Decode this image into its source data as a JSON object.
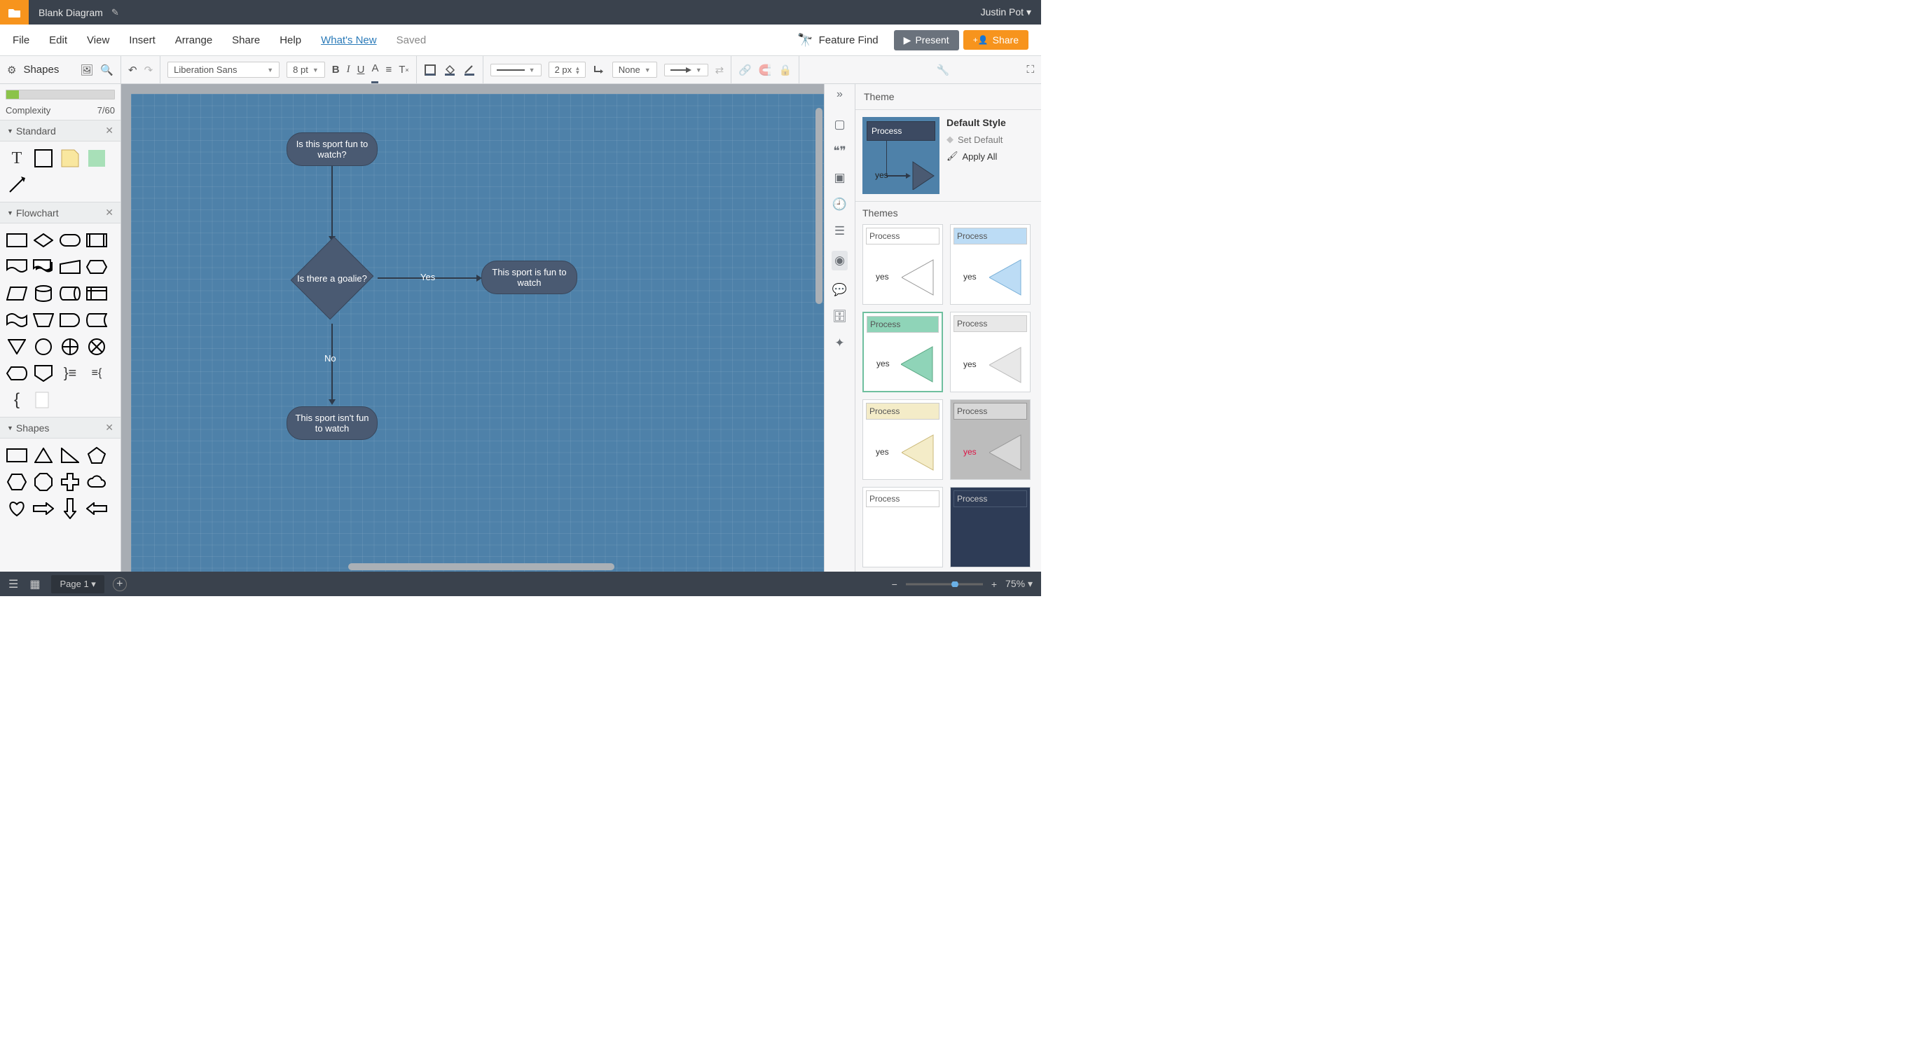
{
  "titlebar": {
    "title": "Blank Diagram",
    "user": "Justin Pot"
  },
  "menubar": {
    "items": [
      "File",
      "Edit",
      "View",
      "Insert",
      "Arrange",
      "Share",
      "Help"
    ],
    "whatsnew": "What's New",
    "saved": "Saved",
    "feature_find": "Feature Find",
    "present": "Present",
    "share": "Share"
  },
  "toolbar": {
    "shapes_label": "Shapes",
    "font": "Liberation Sans",
    "font_size": "8 pt",
    "line_width": "2 px",
    "line_style": "None"
  },
  "left": {
    "complexity_label": "Complexity",
    "complexity_value": "7/60",
    "sections": {
      "standard": "Standard",
      "flowchart": "Flowchart",
      "shapes": "Shapes"
    }
  },
  "right": {
    "theme_header": "Theme",
    "default_style": "Default Style",
    "set_default": "Set Default",
    "apply_all": "Apply All",
    "themes_header": "Themes",
    "process": "Process",
    "yes": "yes"
  },
  "canvas": {
    "nodes": {
      "n1": "Is this sport fun to watch?",
      "n2": "Is there a goalie?",
      "n3": "This sport is fun to watch",
      "n4": "This sport isn't fun to watch"
    },
    "edges": {
      "yes": "Yes",
      "no": "No"
    }
  },
  "statusbar": {
    "page": "Page 1",
    "zoom": "75%"
  }
}
